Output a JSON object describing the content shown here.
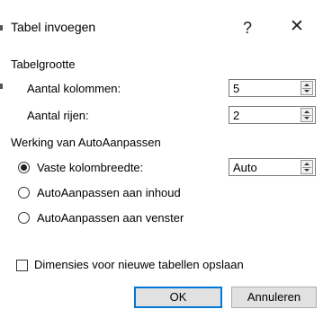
{
  "dialog": {
    "title": "Tabel invoegen",
    "help_label": "?",
    "close_label": "✕"
  },
  "table_size": {
    "group_label": "Tabelgrootte",
    "columns": {
      "label": "Aantal kolommen:",
      "value": "5"
    },
    "rows": {
      "label": "Aantal rijen:",
      "value": "2"
    }
  },
  "autofit": {
    "group_label": "Werking van AutoAanpassen",
    "fixed_width": {
      "label": "Vaste kolombreedte:",
      "selected": true,
      "value": "Auto"
    },
    "autofit_contents": {
      "label": "AutoAanpassen aan inhoud",
      "selected": false
    },
    "autofit_window": {
      "label": "AutoAanpassen aan venster",
      "selected": false
    }
  },
  "remember": {
    "label": "Dimensies voor nieuwe tabellen opslaan",
    "checked": false
  },
  "buttons": {
    "ok": "OK",
    "cancel": "Annuleren"
  },
  "colors": {
    "default_button_border": "#0078d7",
    "button_bg": "#e1e1e1"
  }
}
